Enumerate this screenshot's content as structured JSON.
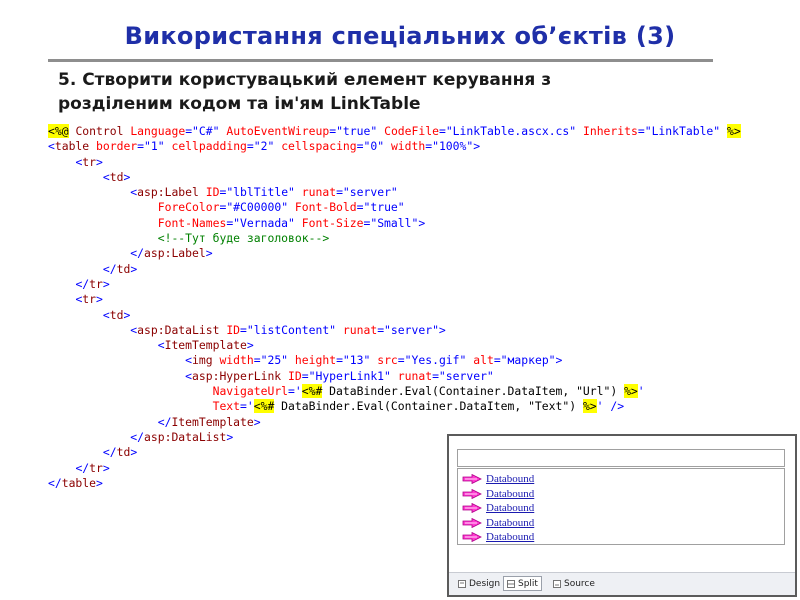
{
  "slide": {
    "title": "Використання спеціальних об’єктів (3)",
    "subtitle_line1": "5. Створити користувацький елемент керування з",
    "subtitle_line2": "розділеним кодом та ім'ям LinkTable"
  },
  "code_lines": [
    {
      "indent": "",
      "parts": [
        {
          "t": "hl",
          "s": "<%@"
        },
        {
          "t": "text",
          "s": " "
        },
        {
          "t": "tag",
          "s": "Control"
        },
        {
          "t": "text",
          "s": " "
        },
        {
          "t": "attr",
          "s": "Language"
        },
        {
          "t": "val",
          "s": "=\"C#\""
        },
        {
          "t": "text",
          "s": " "
        },
        {
          "t": "attr",
          "s": "AutoEventWireup"
        },
        {
          "t": "val",
          "s": "=\"true\""
        },
        {
          "t": "text",
          "s": " "
        },
        {
          "t": "attr",
          "s": "CodeFile"
        },
        {
          "t": "val",
          "s": "=\"LinkTable.ascx.cs\""
        },
        {
          "t": "text",
          "s": " "
        },
        {
          "t": "attr",
          "s": "Inherits"
        },
        {
          "t": "val",
          "s": "=\"LinkTable\""
        },
        {
          "t": "text",
          "s": " "
        },
        {
          "t": "hl",
          "s": "%>"
        }
      ]
    },
    {
      "indent": "",
      "parts": [
        {
          "t": "val",
          "s": "<"
        },
        {
          "t": "tag",
          "s": "table"
        },
        {
          "t": "text",
          "s": " "
        },
        {
          "t": "attr",
          "s": "border"
        },
        {
          "t": "val",
          "s": "=\"1\""
        },
        {
          "t": "text",
          "s": " "
        },
        {
          "t": "attr",
          "s": "cellpadding"
        },
        {
          "t": "val",
          "s": "=\"2\""
        },
        {
          "t": "text",
          "s": " "
        },
        {
          "t": "attr",
          "s": "cellspacing"
        },
        {
          "t": "val",
          "s": "=\"0\""
        },
        {
          "t": "text",
          "s": " "
        },
        {
          "t": "attr",
          "s": "width"
        },
        {
          "t": "val",
          "s": "=\"100%\">"
        }
      ]
    },
    {
      "indent": "    ",
      "parts": [
        {
          "t": "val",
          "s": "<"
        },
        {
          "t": "tag",
          "s": "tr"
        },
        {
          "t": "val",
          "s": ">"
        }
      ]
    },
    {
      "indent": "        ",
      "parts": [
        {
          "t": "val",
          "s": "<"
        },
        {
          "t": "tag",
          "s": "td"
        },
        {
          "t": "val",
          "s": ">"
        }
      ]
    },
    {
      "indent": "            ",
      "parts": [
        {
          "t": "val",
          "s": "<"
        },
        {
          "t": "tag",
          "s": "asp:Label"
        },
        {
          "t": "text",
          "s": " "
        },
        {
          "t": "attr",
          "s": "ID"
        },
        {
          "t": "val",
          "s": "=\"lblTitle\""
        },
        {
          "t": "text",
          "s": " "
        },
        {
          "t": "attr",
          "s": "runat"
        },
        {
          "t": "val",
          "s": "=\"server\""
        }
      ]
    },
    {
      "indent": "                ",
      "parts": [
        {
          "t": "attr",
          "s": "ForeColor"
        },
        {
          "t": "val",
          "s": "=\"#C00000\""
        },
        {
          "t": "text",
          "s": " "
        },
        {
          "t": "attr",
          "s": "Font-Bold"
        },
        {
          "t": "val",
          "s": "=\"true\""
        }
      ]
    },
    {
      "indent": "                ",
      "parts": [
        {
          "t": "attr",
          "s": "Font-Names"
        },
        {
          "t": "val",
          "s": "=\"Vernada\""
        },
        {
          "t": "text",
          "s": " "
        },
        {
          "t": "attr",
          "s": "Font-Size"
        },
        {
          "t": "val",
          "s": "=\"Small\">"
        }
      ]
    },
    {
      "indent": "                ",
      "parts": [
        {
          "t": "comment",
          "s": "<!--Тут буде заголовок-->"
        }
      ]
    },
    {
      "indent": "            ",
      "parts": [
        {
          "t": "val",
          "s": "</"
        },
        {
          "t": "tag",
          "s": "asp:Label"
        },
        {
          "t": "val",
          "s": ">"
        }
      ]
    },
    {
      "indent": "        ",
      "parts": [
        {
          "t": "val",
          "s": "</"
        },
        {
          "t": "tag",
          "s": "td"
        },
        {
          "t": "val",
          "s": ">"
        }
      ]
    },
    {
      "indent": "    ",
      "parts": [
        {
          "t": "val",
          "s": "</"
        },
        {
          "t": "tag",
          "s": "tr"
        },
        {
          "t": "val",
          "s": ">"
        }
      ]
    },
    {
      "indent": "    ",
      "parts": [
        {
          "t": "val",
          "s": "<"
        },
        {
          "t": "tag",
          "s": "tr"
        },
        {
          "t": "val",
          "s": ">"
        }
      ]
    },
    {
      "indent": "        ",
      "parts": [
        {
          "t": "val",
          "s": "<"
        },
        {
          "t": "tag",
          "s": "td"
        },
        {
          "t": "val",
          "s": ">"
        }
      ]
    },
    {
      "indent": "            ",
      "parts": [
        {
          "t": "val",
          "s": "<"
        },
        {
          "t": "tag",
          "s": "asp:DataList"
        },
        {
          "t": "text",
          "s": " "
        },
        {
          "t": "attr",
          "s": "ID"
        },
        {
          "t": "val",
          "s": "=\"listContent\""
        },
        {
          "t": "text",
          "s": " "
        },
        {
          "t": "attr",
          "s": "runat"
        },
        {
          "t": "val",
          "s": "=\"server\">"
        }
      ]
    },
    {
      "indent": "                ",
      "parts": [
        {
          "t": "val",
          "s": "<"
        },
        {
          "t": "tag",
          "s": "ItemTemplate"
        },
        {
          "t": "val",
          "s": ">"
        }
      ]
    },
    {
      "indent": "                    ",
      "parts": [
        {
          "t": "val",
          "s": "<"
        },
        {
          "t": "tag",
          "s": "img"
        },
        {
          "t": "text",
          "s": " "
        },
        {
          "t": "attr",
          "s": "width"
        },
        {
          "t": "val",
          "s": "=\"25\""
        },
        {
          "t": "text",
          "s": " "
        },
        {
          "t": "attr",
          "s": "height"
        },
        {
          "t": "val",
          "s": "=\"13\""
        },
        {
          "t": "text",
          "s": " "
        },
        {
          "t": "attr",
          "s": "src"
        },
        {
          "t": "val",
          "s": "=\"Yes.gif\""
        },
        {
          "t": "text",
          "s": " "
        },
        {
          "t": "attr",
          "s": "alt"
        },
        {
          "t": "val",
          "s": "=\"маркер\">"
        }
      ]
    },
    {
      "indent": "                    ",
      "parts": [
        {
          "t": "val",
          "s": "<"
        },
        {
          "t": "tag",
          "s": "asp:HyperLink"
        },
        {
          "t": "text",
          "s": " "
        },
        {
          "t": "attr",
          "s": "ID"
        },
        {
          "t": "val",
          "s": "=\"HyperLink1\""
        },
        {
          "t": "text",
          "s": " "
        },
        {
          "t": "attr",
          "s": "runat"
        },
        {
          "t": "val",
          "s": "=\"server\""
        }
      ]
    },
    {
      "indent": "                        ",
      "parts": [
        {
          "t": "attr",
          "s": "NavigateUrl"
        },
        {
          "t": "val",
          "s": "='"
        },
        {
          "t": "hl",
          "s": "<%#"
        },
        {
          "t": "text",
          "s": " DataBinder.Eval(Container.DataItem, \"Url\") "
        },
        {
          "t": "hl",
          "s": "%>"
        },
        {
          "t": "val",
          "s": "'"
        }
      ]
    },
    {
      "indent": "                        ",
      "parts": [
        {
          "t": "attr",
          "s": "Text"
        },
        {
          "t": "val",
          "s": "='"
        },
        {
          "t": "hl",
          "s": "<%#"
        },
        {
          "t": "text",
          "s": " DataBinder.Eval(Container.DataItem, \"Text\") "
        },
        {
          "t": "hl",
          "s": "%>"
        },
        {
          "t": "val",
          "s": "' />"
        }
      ]
    },
    {
      "indent": "                ",
      "parts": [
        {
          "t": "val",
          "s": "</"
        },
        {
          "t": "tag",
          "s": "ItemTemplate"
        },
        {
          "t": "val",
          "s": ">"
        }
      ]
    },
    {
      "indent": "            ",
      "parts": [
        {
          "t": "val",
          "s": "</"
        },
        {
          "t": "tag",
          "s": "asp:DataList"
        },
        {
          "t": "val",
          "s": ">"
        }
      ]
    },
    {
      "indent": "        ",
      "parts": [
        {
          "t": "val",
          "s": "</"
        },
        {
          "t": "tag",
          "s": "td"
        },
        {
          "t": "val",
          "s": ">"
        }
      ]
    },
    {
      "indent": "    ",
      "parts": [
        {
          "t": "val",
          "s": "</"
        },
        {
          "t": "tag",
          "s": "tr"
        },
        {
          "t": "val",
          "s": ">"
        }
      ]
    },
    {
      "indent": "",
      "parts": [
        {
          "t": "val",
          "s": "</"
        },
        {
          "t": "tag",
          "s": "table"
        },
        {
          "t": "val",
          "s": ">"
        }
      ]
    }
  ],
  "preview": {
    "items": [
      "Databound",
      "Databound",
      "Databound",
      "Databound",
      "Databound"
    ],
    "marker_icon": "arrow-marker-icon",
    "tabs": [
      {
        "label": "Design",
        "icon": "design-view-icon",
        "active": false
      },
      {
        "label": "Split",
        "icon": "split-view-icon",
        "active": true
      },
      {
        "label": "Source",
        "icon": "source-view-icon",
        "active": false
      }
    ]
  },
  "colors": {
    "title": "#1f2fa8",
    "tag": "#8b0000",
    "attribute": "#ff0000",
    "value": "#0000ff",
    "comment": "#008000",
    "highlight": "#ffff00",
    "link": "#1a1ab0"
  }
}
